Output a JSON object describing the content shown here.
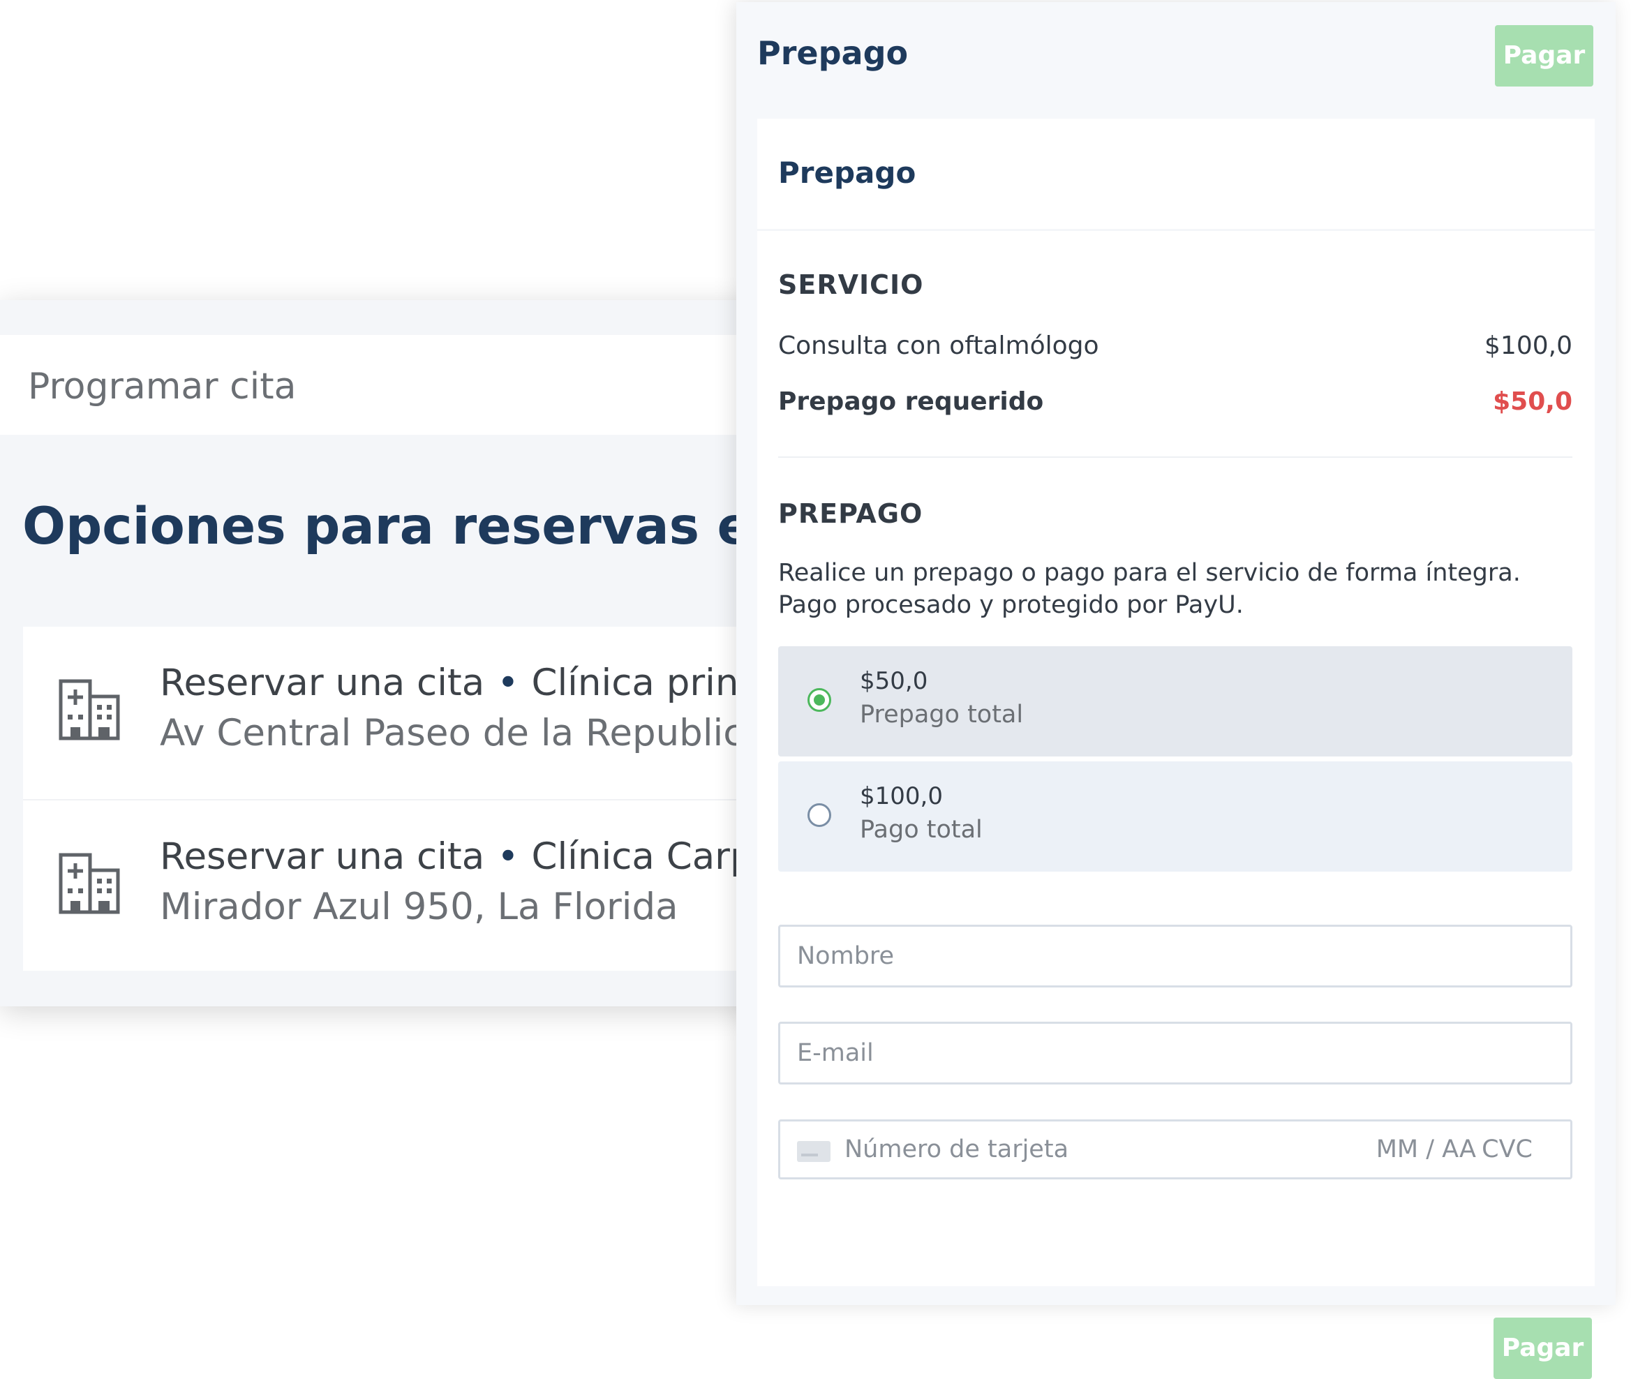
{
  "booking": {
    "header_title": "Programar cita",
    "heading": "Opciones para reservas en lín",
    "separator": "•",
    "locations": [
      {
        "type": "Reservar una cita",
        "clinic": "Clínica princip",
        "address": "Av Central Paseo de la Republica,"
      },
      {
        "type": "Reservar una cita",
        "clinic": "Clínica Carpe l",
        "address": "Mirador Azul 950, La Florida"
      }
    ],
    "icon": "hospital-building-icon"
  },
  "prepago": {
    "panel_title": "Prepago",
    "pay_button": "Pagar",
    "card_title": "Prepago",
    "service": {
      "section_label": "SERVICIO",
      "item_label": "Consulta con oftalmólogo",
      "item_price": "$100,0",
      "required_label": "Prepago requerido",
      "required_amount": "$50,0"
    },
    "payment": {
      "section_label": "PREPAGO",
      "description": "Realice un prepago o pago para el servicio de forma íntegra. Pago procesado y protegido por PayU.",
      "options": [
        {
          "amount": "$50,0",
          "label": "Prepago total",
          "selected": true
        },
        {
          "amount": "$100,0",
          "label": "Pago total",
          "selected": false
        }
      ]
    },
    "form": {
      "name_placeholder": "Nombre",
      "email_placeholder": "E-mail",
      "card_placeholder": "Número de tarjeta",
      "expiry_placeholder": "MM / AA",
      "cvc_placeholder": "CVC"
    },
    "submit_button": "Pagar"
  },
  "colors": {
    "heading": "#1e3a5c",
    "pay_button": "#a7dfb0",
    "required_amount": "#e04e4e",
    "radio_selected": "#4cb85c"
  }
}
